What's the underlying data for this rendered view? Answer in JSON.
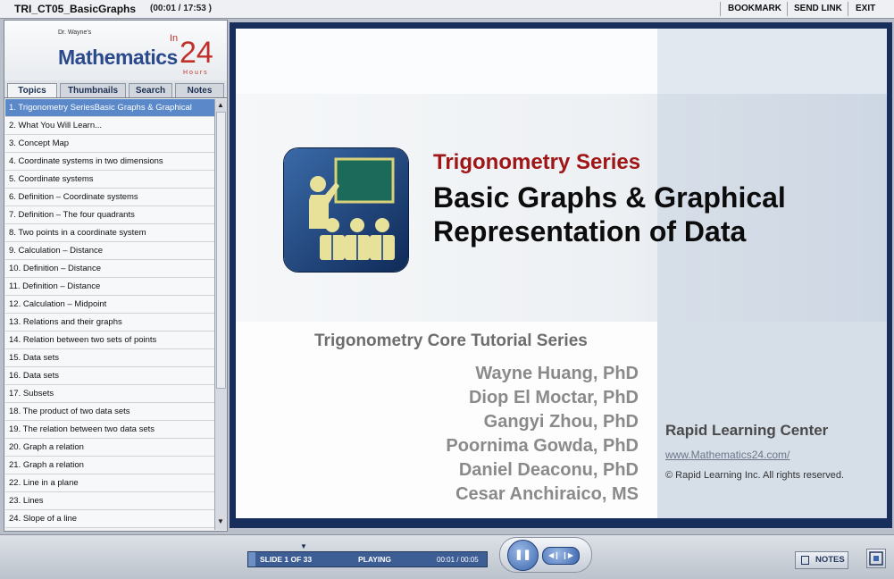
{
  "header": {
    "title": "TRI_CT05_BasicGraphs",
    "time": "(00:01 / 17:53 )",
    "links": [
      "BOOKMARK",
      "SEND LINK",
      "EXIT"
    ]
  },
  "logo": {
    "prefix": "Dr. Wayne's",
    "name": "Mathematics",
    "in": "In",
    "num": "24",
    "suffix": "Hours"
  },
  "tabs": [
    "Topics",
    "Thumbnails",
    "Search",
    "Notes"
  ],
  "topics": [
    "1. Trigonometry SeriesBasic Graphs & Graphical",
    "2. What You Will Learn...",
    "3. Concept Map",
    "4. Coordinate systems in two dimensions",
    "5. Coordinate systems",
    "6. Definition – Coordinate systems",
    "7. Definition – The four quadrants",
    "8. Two points in a coordinate system",
    "9. Calculation – Distance",
    "10. Definition – Distance",
    "11. Definition – Distance",
    "12. Calculation – Midpoint",
    "13. Relations and their graphs",
    "14. Relation between two sets of points",
    "15. Data sets",
    "16. Data sets",
    "17. Subsets",
    "18. The product of two data sets",
    "19. The relation between two data sets",
    "20. Graph a relation",
    "21. Graph a relation",
    "22. Line in a plane",
    "23. Lines",
    "24. Slope of a line"
  ],
  "selected_topic_index": 0,
  "slide": {
    "series": "Trigonometry Series",
    "title_line1": "Basic Graphs & Graphical",
    "title_line2": "Representation of Data",
    "core": "Trigonometry Core Tutorial Series",
    "authors": [
      "Wayne Huang, PhD",
      "Diop El Moctar, PhD",
      "Gangyi Zhou, PhD",
      "Poornima Gowda, PhD",
      "Daniel Deaconu, PhD",
      "Cesar Anchiraico,  MS"
    ],
    "org": "Rapid Learning Center",
    "url": "www.Mathematics24.com/",
    "copyright": "© Rapid Learning Inc. All rights reserved."
  },
  "player": {
    "slide_count": "SLIDE 1 OF 33",
    "status": "PLAYING",
    "time": "00:01 / 00:05",
    "progress": 0.03,
    "pause_icon": "pause-icon",
    "step_icon": "step-icon",
    "notes_label": "NOTES",
    "fullscreen_icon": "fullscreen-icon"
  },
  "colors": {
    "accent": "#2a4a8c",
    "selected_topic": "#5a88c8",
    "series_red": "#a01515",
    "slide_frame": "#182f5d"
  }
}
